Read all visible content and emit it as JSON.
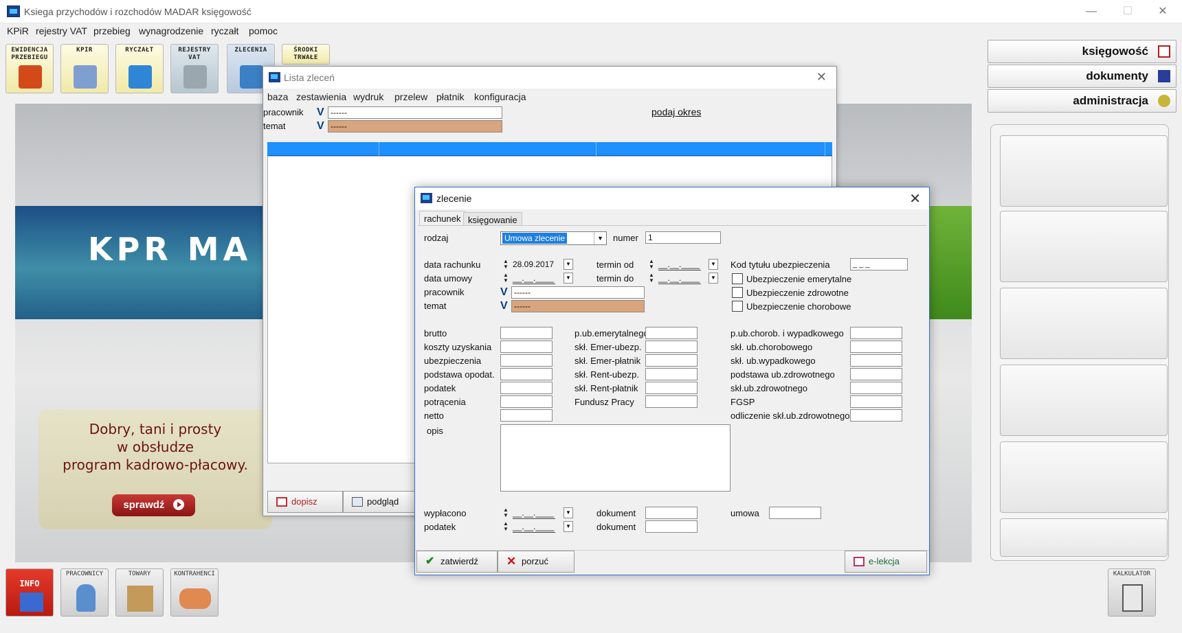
{
  "window": {
    "title": "Ksiega przychodów i rozchodów MADAR  księgowość",
    "minimize": "—",
    "maximize": "☐",
    "close": "✕"
  },
  "menu": [
    "KPiR",
    "rejestry VAT",
    "przebieg",
    "wynagrodzenie",
    "ryczałt",
    "pomoc"
  ],
  "toolbar": [
    {
      "label": "EWIDENCJA\nPRZEBIEGU",
      "icon": "car-icon",
      "color": "#d24a1a"
    },
    {
      "label": "KPIR",
      "icon": "book-icon",
      "color": "#7f9fd0"
    },
    {
      "label": "RYCZAŁT",
      "icon": "blue-book-icon",
      "color": "#2f86d6"
    },
    {
      "label": "REJESTRY\nVAT",
      "icon": "calculator-icon",
      "color": "#9aa7ae"
    },
    {
      "label": "ZLECENIA",
      "icon": "worker-icon",
      "color": "#3b7fc4"
    },
    {
      "label": "ŚRODKI\nTRWAŁE",
      "icon": "assets-icon",
      "color": "#e0c070"
    }
  ],
  "banner": {
    "logo_text": "KPR MA",
    "promo_text": "Dobry, tani i prosty\nw obsłudze\nprogram kadrowo-płacowy.",
    "promo_button": "sprawdź"
  },
  "right_panel": {
    "buttons": [
      "księgowość",
      "dokumenty",
      "administracja"
    ],
    "calculator_label": "KALKULATOR"
  },
  "bottom_toolbar": [
    {
      "label": "INFO",
      "icon": "info-chart-icon"
    },
    {
      "label": "PRACOWNICY",
      "icon": "employee-icon"
    },
    {
      "label": "TOWARY",
      "icon": "box-icon"
    },
    {
      "label": "KONTRAHENCI",
      "icon": "handshake-icon"
    }
  ],
  "lista": {
    "title": "Lista zleceń",
    "menu": [
      "baza",
      "zestawienia",
      "wydruk",
      "przelew",
      "płatnik",
      "konfiguracja"
    ],
    "pracownik_label": "pracownik",
    "pracownik_value": "------",
    "temat_label": "temat",
    "temat_value": "------",
    "period_link": "podaj okres",
    "dopisz": "dopisz",
    "podglad": "podgląd"
  },
  "zlecenie": {
    "title": "zlecenie",
    "tabs": [
      "rachunek",
      "księgowanie"
    ],
    "rodzaj_label": "rodzaj",
    "rodzaj_value": "Umowa zlecenie",
    "numer_label": "numer",
    "numer_value": "1",
    "data_rachunku_label": "data rachunku",
    "data_rachunku_value": "28.09.2017",
    "data_umowy_label": "data umowy",
    "empty_date": "__.__.____",
    "termin_od_label": "termin od",
    "termin_do_label": "termin do",
    "pracownik_label": "pracownik",
    "pracownik_value": "------",
    "temat_label": "temat",
    "temat_value": "------",
    "kod_label": "Kod tytułu ubezpieczenia",
    "kod_value": "_ _ _",
    "checkboxes": [
      "Ubezpieczenie emerytalne",
      "Ubezpieczenie zdrowotne",
      "Ubezpieczenie chorobowe"
    ],
    "col1": [
      "brutto",
      "koszty uzyskania",
      "ubezpieczenia",
      "podstawa opodat.",
      "podatek",
      "potrącenia",
      "netto"
    ],
    "col2": [
      "p.ub.emerytalnego",
      "skł. Emer-ubezp.",
      "skł. Emer-płatnik",
      "skł. Rent-ubezp.",
      "skł. Rent-płatnik",
      "Fundusz Pracy"
    ],
    "col3": [
      "p.ub.chorob. i wypadkowego",
      "skł. ub.chorobowego",
      "skł. ub.wypadkowego",
      "podstawa ub.zdrowotnego",
      "skł.ub.zdrowotnego",
      "FGSP",
      "odliczenie skł.ub.zdrowotnego"
    ],
    "opis_label": "opis",
    "wyplacono_label": "wypłacono",
    "podatek_label": "podatek",
    "dokument_label": "dokument",
    "umowa_label": "umowa",
    "zatwierdz": "zatwierdź",
    "porzuc": "porzuć",
    "elekcja": "e-lekcja"
  },
  "colors": {
    "grid_header": "#1e90ff",
    "selection": "#1e7fe0",
    "tan_field": "#d9a57c",
    "promo_button": "#b02724"
  }
}
